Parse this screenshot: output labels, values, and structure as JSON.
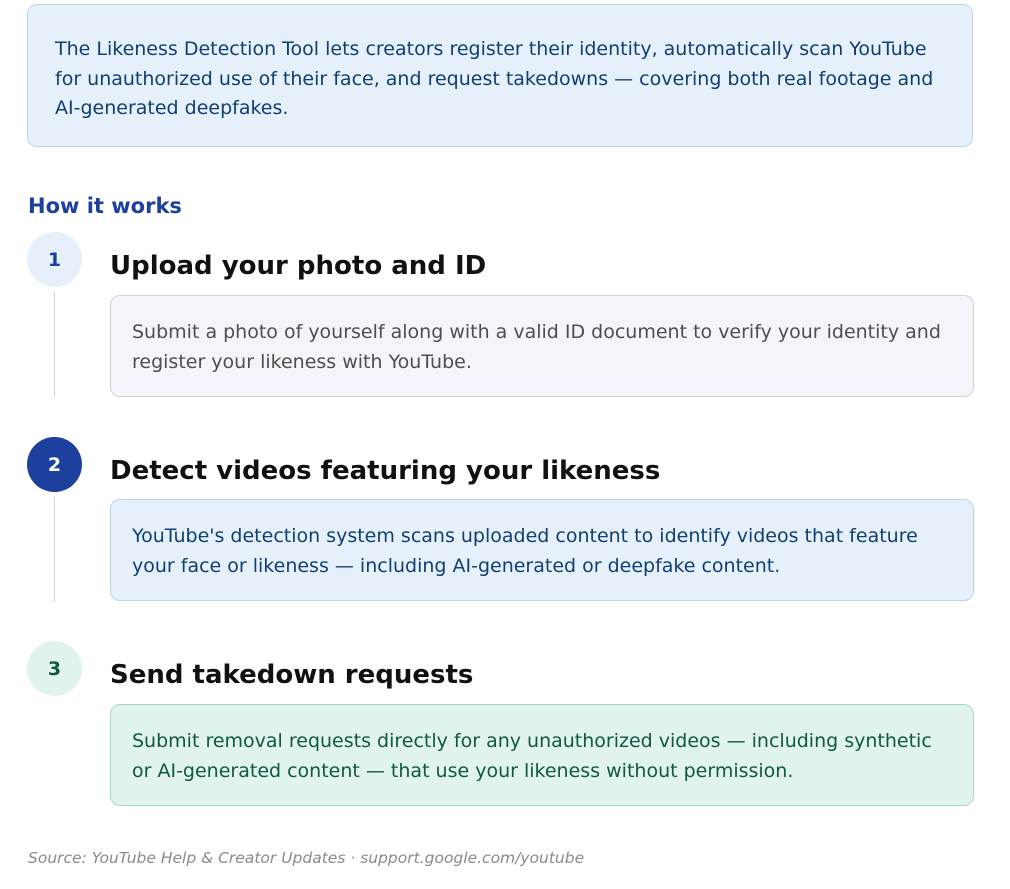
{
  "intro": {
    "text": "The Likeness Detection Tool lets creators register their identity, automatically scan YouTube for unauthorized use of their face, and request takedowns — covering both real footage and AI-generated deepfakes."
  },
  "section": {
    "heading": "How it works"
  },
  "steps": [
    {
      "number": "1",
      "title": "Upload your photo and ID",
      "description": "Submit a photo of yourself along with a valid ID document to verify your identity and register your likeness with YouTube."
    },
    {
      "number": "2",
      "title": "Detect videos featuring your likeness",
      "description": "YouTube's detection system scans uploaded content to identify videos that feature your face or likeness — including AI-generated or deepfake content."
    },
    {
      "number": "3",
      "title": "Send takedown requests",
      "description": "Submit removal requests directly for any unauthorized videos — including synthetic or AI-generated content — that use your likeness without permission."
    }
  ],
  "footer": {
    "source": "Source: YouTube Help & Creator Updates · support.google.com/youtube"
  },
  "colors": {
    "accent_blue": "#1d3f9e",
    "info_bg": "#e6f0fb",
    "success_bg": "#e0f3ec",
    "success_text": "#0e5a3c",
    "neutral_bg": "#f3f5fa"
  }
}
